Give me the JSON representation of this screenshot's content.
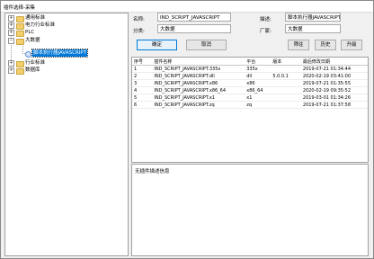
{
  "window": {
    "title": "插件选择-采集"
  },
  "tree": {
    "nodes": [
      {
        "label": "通用标准",
        "expander": "+"
      },
      {
        "label": "电力行业标准",
        "expander": "+"
      },
      {
        "label": "PLC",
        "expander": "+"
      },
      {
        "label": "大数据",
        "expander": "−"
      },
      {
        "label": "脚本执行器JAVASCRIPT",
        "selected": true
      },
      {
        "label": "行业标准",
        "expander": "+"
      },
      {
        "label": "数据库",
        "expander": "+"
      }
    ]
  },
  "form": {
    "name_label": "名称:",
    "name_value": "IND_SCRIPT_JAVASCRIPT",
    "desc_label": "描述:",
    "desc_value": "脚本执行器JAVASCRIPT",
    "category_label": "分类:",
    "category_value": "大数据",
    "vendor_label": "厂家:",
    "vendor_value": "大数据"
  },
  "buttons": {
    "ok": "确定",
    "cancel": "取消",
    "filter": "筛往",
    "history": "历史",
    "upgrade": "升级"
  },
  "table": {
    "headers": [
      "序号",
      "插件名称",
      "平台",
      "版本",
      "最后修改日期"
    ],
    "rows": [
      [
        "1",
        "IND_SCRIPT_JAVASCRIPT.335x",
        "335x",
        "",
        "2019-07-21 01:34:44"
      ],
      [
        "2",
        "IND_SCRIPT_JAVASCRIPT.dll",
        "dll",
        "5.0.0.1",
        "2020-02-19 03:41:00"
      ],
      [
        "3",
        "IND_SCRIPT_JAVASCRIPT.x86",
        "x86",
        "",
        "2019-07-21 01:35:55"
      ],
      [
        "4",
        "IND_SCRIPT_JAVASCRIPT.x86_64",
        "x86_64",
        "",
        "2020-02-19 09:35:52"
      ],
      [
        "5",
        "IND_SCRIPT_JAVASCRIPT.x1",
        "x1",
        "",
        "2019-03-01 01:34:26"
      ],
      [
        "6",
        "IND_SCRIPT_JAVASCRIPT.zq",
        "zq",
        "",
        "2019-07-21 01:37:58"
      ]
    ]
  },
  "description_panel": {
    "text": "无插件描述信息"
  }
}
